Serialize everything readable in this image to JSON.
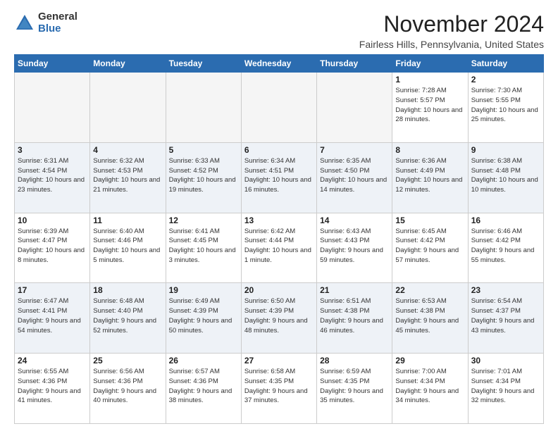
{
  "logo": {
    "general": "General",
    "blue": "Blue"
  },
  "header": {
    "month": "November 2024",
    "location": "Fairless Hills, Pennsylvania, United States"
  },
  "weekdays": [
    "Sunday",
    "Monday",
    "Tuesday",
    "Wednesday",
    "Thursday",
    "Friday",
    "Saturday"
  ],
  "weeks": [
    [
      {
        "day": "",
        "info": ""
      },
      {
        "day": "",
        "info": ""
      },
      {
        "day": "",
        "info": ""
      },
      {
        "day": "",
        "info": ""
      },
      {
        "day": "",
        "info": ""
      },
      {
        "day": "1",
        "info": "Sunrise: 7:28 AM\nSunset: 5:57 PM\nDaylight: 10 hours\nand 28 minutes."
      },
      {
        "day": "2",
        "info": "Sunrise: 7:30 AM\nSunset: 5:55 PM\nDaylight: 10 hours\nand 25 minutes."
      }
    ],
    [
      {
        "day": "3",
        "info": "Sunrise: 6:31 AM\nSunset: 4:54 PM\nDaylight: 10 hours\nand 23 minutes."
      },
      {
        "day": "4",
        "info": "Sunrise: 6:32 AM\nSunset: 4:53 PM\nDaylight: 10 hours\nand 21 minutes."
      },
      {
        "day": "5",
        "info": "Sunrise: 6:33 AM\nSunset: 4:52 PM\nDaylight: 10 hours\nand 19 minutes."
      },
      {
        "day": "6",
        "info": "Sunrise: 6:34 AM\nSunset: 4:51 PM\nDaylight: 10 hours\nand 16 minutes."
      },
      {
        "day": "7",
        "info": "Sunrise: 6:35 AM\nSunset: 4:50 PM\nDaylight: 10 hours\nand 14 minutes."
      },
      {
        "day": "8",
        "info": "Sunrise: 6:36 AM\nSunset: 4:49 PM\nDaylight: 10 hours\nand 12 minutes."
      },
      {
        "day": "9",
        "info": "Sunrise: 6:38 AM\nSunset: 4:48 PM\nDaylight: 10 hours\nand 10 minutes."
      }
    ],
    [
      {
        "day": "10",
        "info": "Sunrise: 6:39 AM\nSunset: 4:47 PM\nDaylight: 10 hours\nand 8 minutes."
      },
      {
        "day": "11",
        "info": "Sunrise: 6:40 AM\nSunset: 4:46 PM\nDaylight: 10 hours\nand 5 minutes."
      },
      {
        "day": "12",
        "info": "Sunrise: 6:41 AM\nSunset: 4:45 PM\nDaylight: 10 hours\nand 3 minutes."
      },
      {
        "day": "13",
        "info": "Sunrise: 6:42 AM\nSunset: 4:44 PM\nDaylight: 10 hours\nand 1 minute."
      },
      {
        "day": "14",
        "info": "Sunrise: 6:43 AM\nSunset: 4:43 PM\nDaylight: 9 hours\nand 59 minutes."
      },
      {
        "day": "15",
        "info": "Sunrise: 6:45 AM\nSunset: 4:42 PM\nDaylight: 9 hours\nand 57 minutes."
      },
      {
        "day": "16",
        "info": "Sunrise: 6:46 AM\nSunset: 4:42 PM\nDaylight: 9 hours\nand 55 minutes."
      }
    ],
    [
      {
        "day": "17",
        "info": "Sunrise: 6:47 AM\nSunset: 4:41 PM\nDaylight: 9 hours\nand 54 minutes."
      },
      {
        "day": "18",
        "info": "Sunrise: 6:48 AM\nSunset: 4:40 PM\nDaylight: 9 hours\nand 52 minutes."
      },
      {
        "day": "19",
        "info": "Sunrise: 6:49 AM\nSunset: 4:39 PM\nDaylight: 9 hours\nand 50 minutes."
      },
      {
        "day": "20",
        "info": "Sunrise: 6:50 AM\nSunset: 4:39 PM\nDaylight: 9 hours\nand 48 minutes."
      },
      {
        "day": "21",
        "info": "Sunrise: 6:51 AM\nSunset: 4:38 PM\nDaylight: 9 hours\nand 46 minutes."
      },
      {
        "day": "22",
        "info": "Sunrise: 6:53 AM\nSunset: 4:38 PM\nDaylight: 9 hours\nand 45 minutes."
      },
      {
        "day": "23",
        "info": "Sunrise: 6:54 AM\nSunset: 4:37 PM\nDaylight: 9 hours\nand 43 minutes."
      }
    ],
    [
      {
        "day": "24",
        "info": "Sunrise: 6:55 AM\nSunset: 4:36 PM\nDaylight: 9 hours\nand 41 minutes."
      },
      {
        "day": "25",
        "info": "Sunrise: 6:56 AM\nSunset: 4:36 PM\nDaylight: 9 hours\nand 40 minutes."
      },
      {
        "day": "26",
        "info": "Sunrise: 6:57 AM\nSunset: 4:36 PM\nDaylight: 9 hours\nand 38 minutes."
      },
      {
        "day": "27",
        "info": "Sunrise: 6:58 AM\nSunset: 4:35 PM\nDaylight: 9 hours\nand 37 minutes."
      },
      {
        "day": "28",
        "info": "Sunrise: 6:59 AM\nSunset: 4:35 PM\nDaylight: 9 hours\nand 35 minutes."
      },
      {
        "day": "29",
        "info": "Sunrise: 7:00 AM\nSunset: 4:34 PM\nDaylight: 9 hours\nand 34 minutes."
      },
      {
        "day": "30",
        "info": "Sunrise: 7:01 AM\nSunset: 4:34 PM\nDaylight: 9 hours\nand 32 minutes."
      }
    ]
  ]
}
